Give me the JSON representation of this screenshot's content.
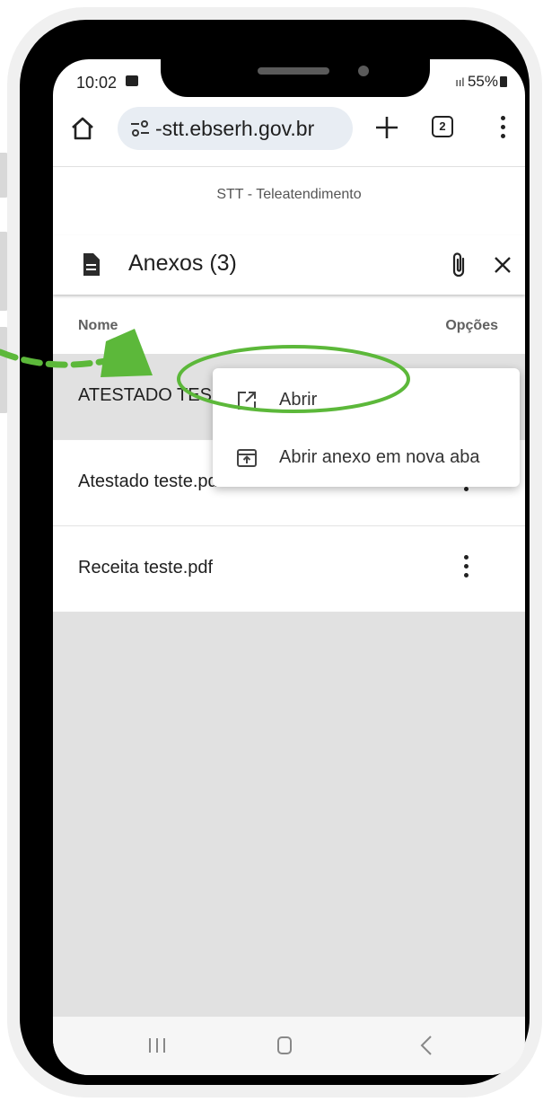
{
  "status_bar": {
    "time": "10:02",
    "battery": "55%"
  },
  "browser": {
    "url": "-stt.ebserh.gov.br",
    "tab_count": "2"
  },
  "site": {
    "title": "STT - Teleatendimento"
  },
  "dialog": {
    "title": "Anexos (3)"
  },
  "table": {
    "col_name": "Nome",
    "col_options": "Opções",
    "rows": [
      {
        "name": "ATESTADO TES"
      },
      {
        "name": "Atestado teste.pdf"
      },
      {
        "name": "Receita teste.pdf"
      }
    ]
  },
  "context_menu": {
    "items": [
      {
        "label": "Abrir",
        "icon": "open-external-icon"
      },
      {
        "label": "Abrir anexo em nova aba",
        "icon": "open-in-new-tab-icon"
      }
    ]
  },
  "colors": {
    "accent_arrow": "#5cb83a",
    "highlight_ellipse": "#5cb83a",
    "selected_row": "#e1e1e1"
  }
}
